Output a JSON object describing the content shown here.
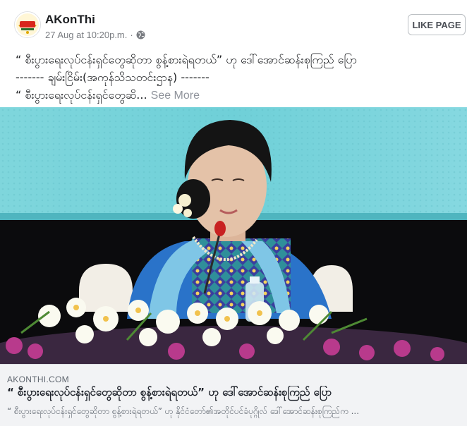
{
  "header": {
    "page_name": "AKonThi",
    "timestamp": "27 Aug at 10:20p.m.",
    "separator": "·",
    "like_button": "LIKE PAGE",
    "avatar_logo_text": "အကုန်သိ"
  },
  "post": {
    "line1": "“ စီးပွားရေးလုပ်ငန်းရှင်တွေဆိုတာ စွန့်စားရဲရတယ်” ဟု ဒေါ်အောင်ဆန်းစုကြည် ပြော",
    "line2": "------- ချမ်းငြိမ်း(အကုန်သိသတင်းဌာန) -------",
    "line3": "“ စီးပွားရေးလုပ်ငန်းရှင်တွေဆိ...",
    "see_more": "See More"
  },
  "link": {
    "domain": "AKONTHI.COM",
    "title": "“ စီးပွားရေးလုပ်ငန်းရှင်တွေဆိုတာ စွန့်စားရဲရတယ်” ဟု ဒေါ်အောင်ဆန်းစုကြည် ပြော",
    "description": "“ စီးပွားရေးလုပ်ငန်းရှင်တွေဆိုတာ စွန့်စားရဲရတယ်” ဟု နိုင်ငံတော်၏အတိုင်ပင်ခံပုဂ္ဂိုလ် ဒေါ်အောင်ဆန်းစုကြည်က ..."
  },
  "colors": {
    "photo_background": "#6fd0d8",
    "speaker_dress": "#2a73c9",
    "sash": "#7fc6e6"
  },
  "icons": {
    "privacy": "globe-icon"
  }
}
